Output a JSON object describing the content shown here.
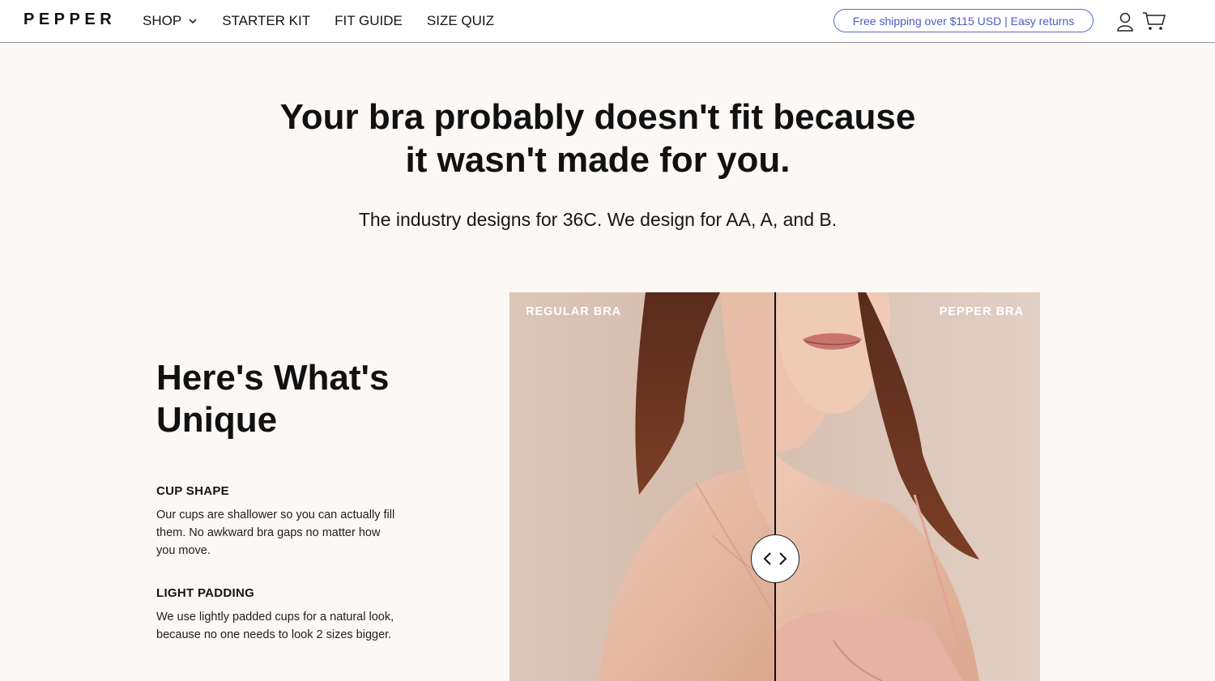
{
  "header": {
    "logo": "PEPPER",
    "nav": [
      {
        "label": "SHOP",
        "has_dropdown": true
      },
      {
        "label": "STARTER KIT"
      },
      {
        "label": "FIT GUIDE"
      },
      {
        "label": "SIZE QUIZ"
      }
    ],
    "promo": "Free shipping over $115 USD | Easy returns",
    "icons": [
      "account-icon",
      "cart-icon"
    ]
  },
  "hero": {
    "headline_line1": "Your bra probably doesn't fit because",
    "headline_line2": "it wasn't made for you.",
    "subhead": "The industry designs for 36C. We design for AA, A, and B."
  },
  "unique": {
    "title": "Here's What's Unique",
    "features": [
      {
        "title": "CUP SHAPE",
        "body": "Our cups are shallower so you can actually fill them. No awkward bra gaps no matter how you move."
      },
      {
        "title": "LIGHT PADDING",
        "body": "We use lightly padded cups for a natural look, because no one needs to look 2 sizes bigger."
      }
    ]
  },
  "comparison": {
    "left_label": "REGULAR BRA",
    "right_label": "PEPPER BRA",
    "slider_position": 0.5
  },
  "colors": {
    "page_bg": "#fcf8f5",
    "accent_blue": "#4a5cc0",
    "photo_bg": "#d9c3b5",
    "bra_pink": "#e7b1a3"
  }
}
